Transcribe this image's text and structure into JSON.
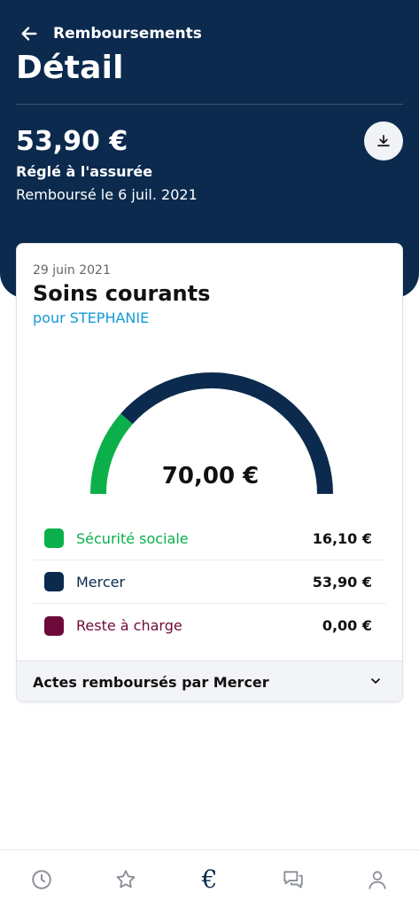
{
  "header": {
    "back_label": "Remboursements",
    "title": "Détail",
    "amount": "53,90 €",
    "status": "Réglé à l'assurée",
    "refund_date": "Remboursé le 6 juil. 2021"
  },
  "card": {
    "date": "29 juin 2021",
    "title": "Soins courants",
    "subtitle": "pour STEPHANIE",
    "total": "70,00 €",
    "breakdown": [
      {
        "label": "Sécurité sociale",
        "value": "16,10 €",
        "amount": 16.1,
        "color": "#0bb04a"
      },
      {
        "label": "Mercer",
        "value": "53,90 €",
        "amount": 53.9,
        "color": "#0b2a4e"
      },
      {
        "label": "Reste à charge",
        "value": "0,00 €",
        "amount": 0.0,
        "color": "#6e0a3a"
      }
    ],
    "acts_label": "Actes remboursés par Mercer"
  },
  "tabbar": {
    "tabs": [
      {
        "icon": "clock-icon",
        "active": false
      },
      {
        "icon": "star-icon",
        "active": false
      },
      {
        "icon": "euro-icon",
        "active": true
      },
      {
        "icon": "chat-icon",
        "active": false
      },
      {
        "icon": "user-icon",
        "active": false
      }
    ]
  },
  "colors": {
    "header_bg": "#0b2a4e",
    "accent_blue": "#139bd6",
    "green": "#0bb04a",
    "navy": "#0b2a4e",
    "burgundy": "#6e0a3a"
  }
}
